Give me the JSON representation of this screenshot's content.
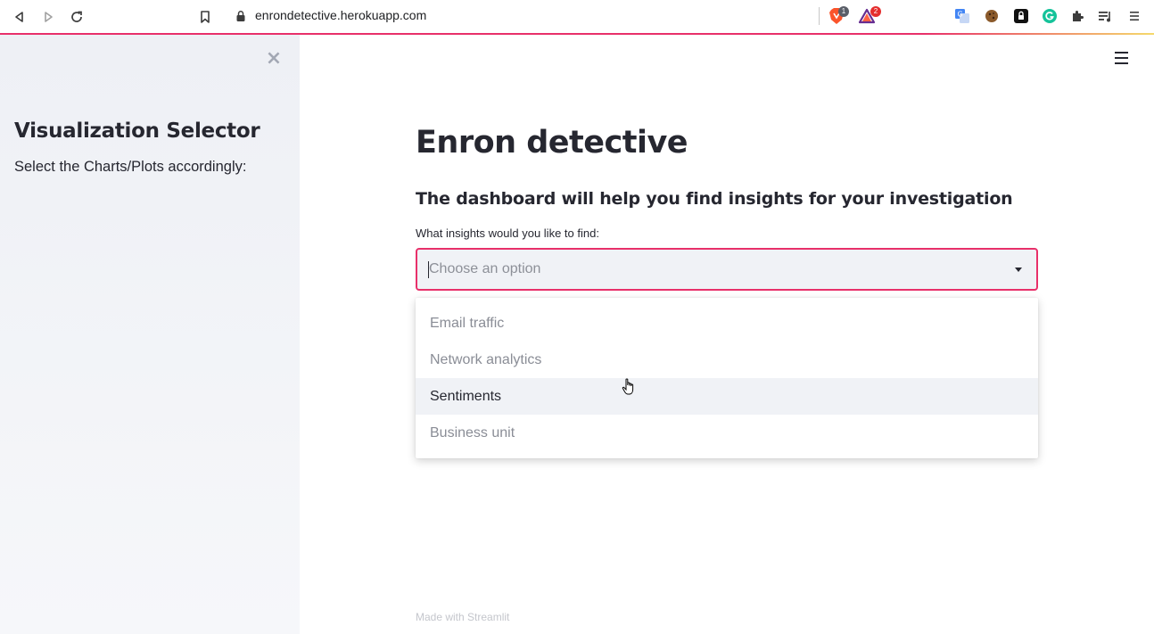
{
  "browser": {
    "url": "enrondetective.herokuapp.com",
    "brave_badge": "1",
    "rewards_badge": "2"
  },
  "sidebar": {
    "title": "Visualization Selector",
    "subtitle": "Select the Charts/Plots accordingly:",
    "close_icon": "×"
  },
  "main": {
    "title": "Enron detective",
    "subtitle": "The dashboard will help you find insights for your investigation",
    "select_label": "What insights would you like to find:",
    "select_placeholder": "Choose an option",
    "options": [
      {
        "label": "Email traffic"
      },
      {
        "label": "Network analytics"
      },
      {
        "label": "Sentiments"
      },
      {
        "label": "Business unit"
      }
    ],
    "hovered_option": "Sentiments",
    "footer": "Made with Streamlit"
  },
  "colors": {
    "accent": "#e8306a",
    "sidebar_bg": "#eef0f5",
    "text": "#262730"
  }
}
